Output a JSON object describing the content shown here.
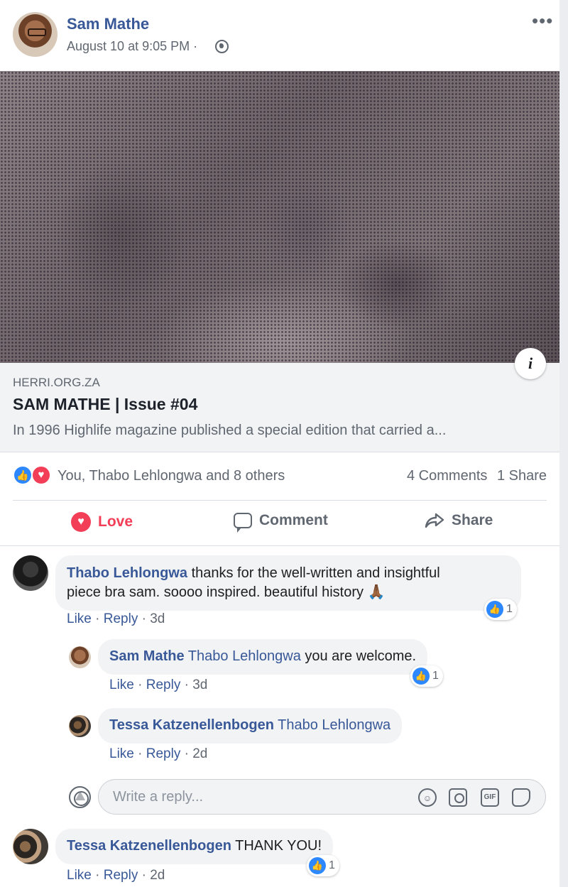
{
  "post": {
    "author": "Sam Mathe",
    "timestamp": "August 10 at 9:05 PM",
    "separator": "·",
    "more_label": "•••",
    "icons": {
      "privacy": "globe-icon",
      "more": "more-options-icon",
      "info": "info-icon"
    },
    "info_label": "i"
  },
  "link": {
    "domain": "HERRI.ORG.ZA",
    "title": "SAM MATHE | Issue #04",
    "description": "In 1996 Highlife magazine published a special edition that carried a..."
  },
  "reactions": {
    "summary": "You, Thabo Lehlongwa and 8 others",
    "comments": "4 Comments",
    "shares": "1 Share",
    "icons": [
      "like-icon",
      "love-icon"
    ],
    "like_glyph": "👍",
    "love_glyph": "♥"
  },
  "actions": {
    "love": "Love",
    "comment": "Comment",
    "share": "Share",
    "love_color": "#f33e58"
  },
  "comments": [
    {
      "author": "Thabo Lehlongwa",
      "text_line1": "thanks for the well-written and insightful",
      "text_line2": "piece bra sam. soooo inspired. beautiful history 🙏🏾",
      "like": "Like",
      "reply": "Reply",
      "age": "3d",
      "reaction_count": "1"
    },
    {
      "author": "Sam Mathe",
      "mention": "Thabo Lehlongwa",
      "text": "you are welcome.",
      "like": "Like",
      "reply": "Reply",
      "age": "3d",
      "reaction_count": "1"
    },
    {
      "author": "Tessa Katzenellenbogen",
      "mention": "Thabo Lehlongwa",
      "text": "",
      "like": "Like",
      "reply": "Reply",
      "age": "2d"
    },
    {
      "author": "Tessa Katzenellenbogen",
      "text": "THANK YOU!",
      "like": "Like",
      "reply": "Reply",
      "age": "2d",
      "reaction_count": "1"
    }
  ],
  "reply_box": {
    "placeholder": "Write a reply...",
    "gif_label": "GIF",
    "tools": [
      "emoji-icon",
      "camera-icon",
      "gif-icon",
      "sticker-icon"
    ]
  },
  "colors": {
    "link_blue": "#385898",
    "like_blue": "#2d88ff",
    "love_red": "#f33e58",
    "muted": "#606770"
  }
}
